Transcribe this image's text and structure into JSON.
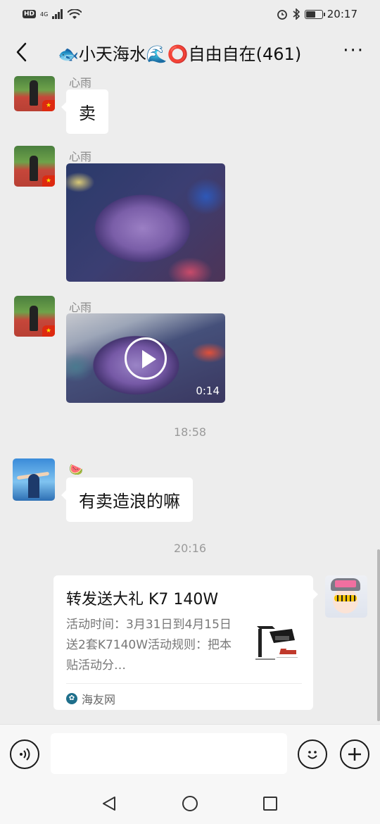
{
  "status_bar": {
    "left_badge": "HD",
    "network": "4G",
    "time": "20:17",
    "battery_level": 0.55
  },
  "header": {
    "title": "🐟小天海水🌊⭕自由自在(461)",
    "more_glyph": "···"
  },
  "messages": [
    {
      "sender": "心雨",
      "type": "text",
      "text": "卖"
    },
    {
      "sender": "心雨",
      "type": "image",
      "description_icon": "coral-photo"
    },
    {
      "sender": "心雨",
      "type": "video",
      "duration": "0:14"
    }
  ],
  "time_separators": [
    "18:58",
    "20:16"
  ],
  "message_4": {
    "sender": "🍉",
    "text": "有卖造浪的嘛"
  },
  "link_card": {
    "title": "转发送大礼 K7 140W",
    "description": "活动时间：3月31日到4月15日送2套K7140W活动规则：把本贴活动分…",
    "source": "海友网"
  },
  "icons": {
    "back": "chevron-left-icon",
    "more": "more-dots-icon",
    "voice": "voice-icon",
    "emoji": "emoji-icon",
    "plus": "plus-icon"
  }
}
